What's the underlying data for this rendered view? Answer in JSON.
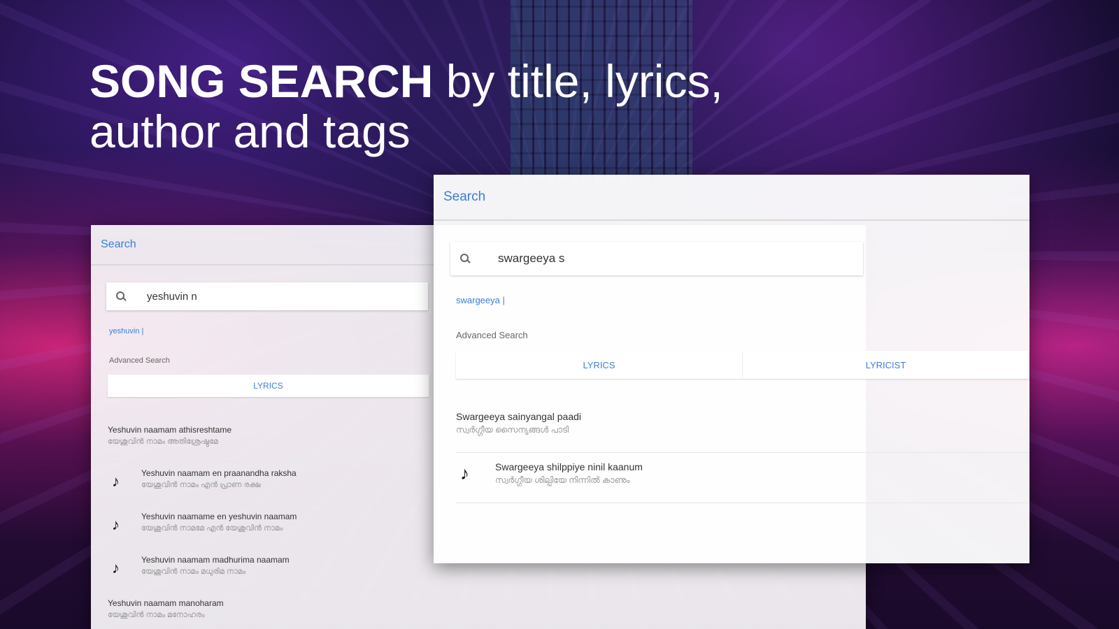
{
  "headline": {
    "bold": "SONG SEARCH",
    "rest": " by title, lyrics,",
    "line2": "author and tags"
  },
  "back_panel": {
    "title": "Search",
    "search_value": "yeshuvin n",
    "suggestion": "yeshuvin |",
    "advanced_label": "Advanced Search",
    "tabs": [
      "LYRICS"
    ],
    "results": [
      {
        "title": "Yeshuvin naamam athisreshtame",
        "sub": "യേശുവിൻ നാമം അതിശ്രേഷ്ഠമേ",
        "icon": ""
      },
      {
        "title": "Yeshuvin naamam en praanandha raksha",
        "sub": "യേശുവിൻ നാമം എൻ പ്രാണ രക്ഷ",
        "icon": "music-note-icon"
      },
      {
        "title": "Yeshuvin naamame en yeshuvin naamam",
        "sub": "യേശുവിൻ നാമമേ എൻ യേശുവിൻ നാമം",
        "icon": "music-note-icon"
      },
      {
        "title": "Yeshuvin naamam madhurima naamam",
        "sub": "യേശുവിൻ നാമം മധുരിമ നാമം",
        "icon": "music-note-icon"
      },
      {
        "title": "Yeshuvin naamam manoharam",
        "sub": "യേശുവിൻ നാമം മനോഹരം",
        "icon": ""
      }
    ]
  },
  "front_panel": {
    "title": "Search",
    "search_value": "swargeeya s",
    "suggestion": "swargeeya |",
    "advanced_label": "Advanced Search",
    "tabs": [
      "LYRICS",
      "LYRICIST"
    ],
    "results": [
      {
        "title": "Swargeeya sainyangal paadi",
        "sub": "സ്വർഗ്ഗീയ സൈന്യങ്ങൾ പാടി",
        "icon": ""
      },
      {
        "title": "Swargeeya shilppiye ninil kaanum",
        "sub": "സ്വർഗ്ഗീയ ശില്പിയേ നിന്നിൽ കാണും",
        "icon": "music-note-icon"
      }
    ]
  },
  "colors": {
    "accent": "#3b7fd9"
  }
}
